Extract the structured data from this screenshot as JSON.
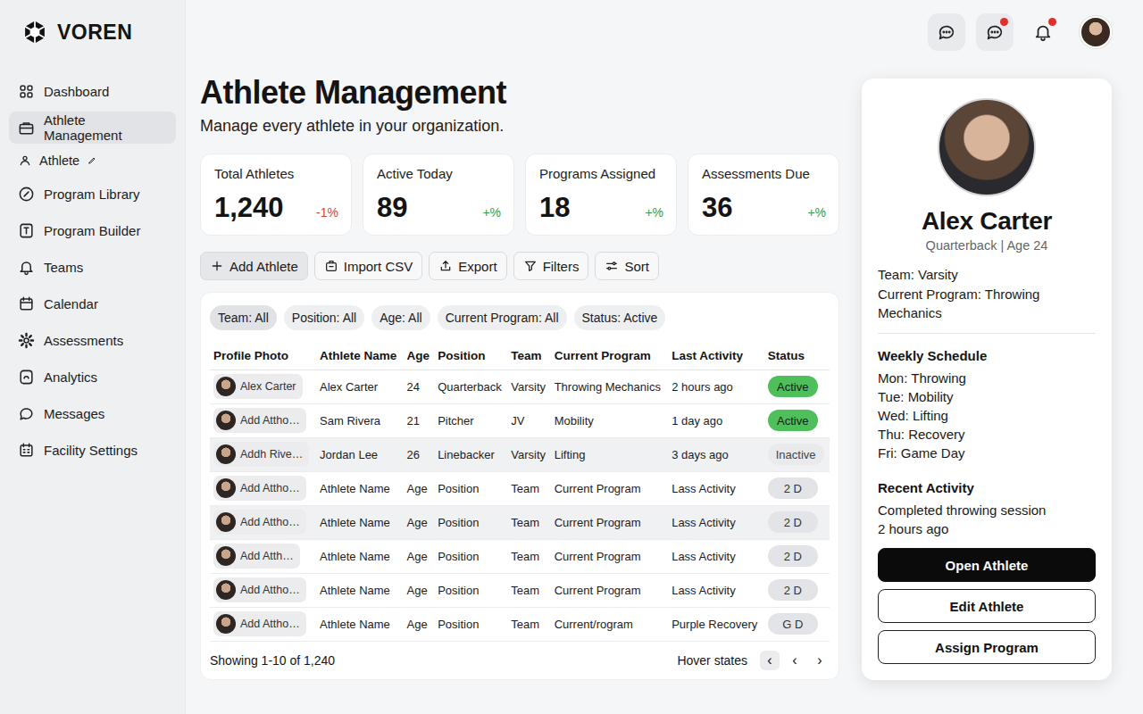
{
  "brand": {
    "name": "VOREN"
  },
  "sidebar": {
    "items": [
      {
        "label": "Dashboard",
        "selected": false,
        "kind": "main"
      },
      {
        "label": "Athlete Management",
        "selected": true,
        "kind": "main"
      },
      {
        "label": "Athlete",
        "selected": false,
        "kind": "sub"
      },
      {
        "label": "Program Library",
        "selected": false,
        "kind": "main"
      },
      {
        "label": "Program Builder",
        "selected": false,
        "kind": "main"
      },
      {
        "label": "Teams",
        "selected": false,
        "kind": "main"
      },
      {
        "label": "Calendar",
        "selected": false,
        "kind": "main"
      },
      {
        "label": "Assessments",
        "selected": false,
        "kind": "main"
      },
      {
        "label": "Analytics",
        "selected": false,
        "kind": "main"
      },
      {
        "label": "Messages",
        "selected": false,
        "kind": "main"
      },
      {
        "label": "Facility Settings",
        "selected": false,
        "kind": "main"
      }
    ]
  },
  "header": {
    "buttons": [
      {
        "badge": false
      },
      {
        "badge": true
      },
      {
        "badge": true
      }
    ]
  },
  "page": {
    "title": "Athlete Management",
    "subtitle": "Manage every athlete in your organization."
  },
  "stats": [
    {
      "label": "Total Athletes",
      "value": "1,240",
      "change": "-1%",
      "color": "#d64545"
    },
    {
      "label": "Active Today",
      "value": "89",
      "change": "+%",
      "color": "#2e9e4f"
    },
    {
      "label": "Programs Assigned",
      "value": "18",
      "change": "+%",
      "color": "#2e9e4f"
    },
    {
      "label": "Assessments Due",
      "value": "36",
      "change": "+%",
      "color": "#2e9e4f"
    }
  ],
  "toolbar": [
    {
      "label": "Add Athlete",
      "selected": true
    },
    {
      "label": "Import CSV",
      "selected": false
    },
    {
      "label": "Export",
      "selected": false
    },
    {
      "label": "Filters",
      "selected": false
    },
    {
      "label": "Sort",
      "selected": false
    }
  ],
  "filters": [
    {
      "label": "Team: All",
      "selected": true
    },
    {
      "label": "Position: All",
      "selected": false
    },
    {
      "label": "Age: All",
      "selected": false
    },
    {
      "label": "Current Program: All",
      "selected": false
    },
    {
      "label": "Status: Active",
      "selected": false
    }
  ],
  "table": {
    "columns": [
      "Profile Photo",
      "Athlete Name",
      "Age",
      "Position",
      "Team",
      "Current Program",
      "Last Activity",
      "Status"
    ],
    "rows": [
      {
        "photo_label": "Alex Carter",
        "cells": [
          "Alex Carter",
          "24",
          "Quarterback",
          "Varsity",
          "Throwing Mechanics",
          "2 hours ago"
        ],
        "status": {
          "label": "Active",
          "kind": "active"
        },
        "selected": false
      },
      {
        "photo_label": "Add Attho…",
        "cells": [
          "Sam Rivera",
          "21",
          "Pitcher",
          "JV",
          "Mobility",
          "1 day ago"
        ],
        "status": {
          "label": "Active",
          "kind": "active"
        },
        "selected": false
      },
      {
        "photo_label": "Addh Rive…",
        "cells": [
          "Jordan Lee",
          "26",
          "Linebacker",
          "Varsity",
          "Lifting",
          "3 days ago"
        ],
        "status": {
          "label": "Inactive",
          "kind": "inactive"
        },
        "selected": true
      },
      {
        "photo_label": "Add Attho…",
        "cells": [
          "Athlete Name",
          "Age",
          "Position",
          "Team",
          "Current Program",
          "Lass Activity"
        ],
        "status": {
          "label": "2 D",
          "kind": "pending"
        },
        "selected": false
      },
      {
        "photo_label": "Add Attho…",
        "cells": [
          "Athlete Name",
          "Age",
          "Position",
          "Team",
          "Current Program",
          "Lass Activity"
        ],
        "status": {
          "label": "2 D",
          "kind": "pending"
        },
        "selected": true
      },
      {
        "photo_label": "Add Atth…",
        "cells": [
          "Athlete Name",
          "Age",
          "Position",
          "Team",
          "Current Program",
          "Lass Activity"
        ],
        "status": {
          "label": "2 D",
          "kind": "pending"
        },
        "selected": false
      },
      {
        "photo_label": "Add Attho…",
        "cells": [
          "Athlete Name",
          "Age",
          "Position",
          "Team",
          "Current Program",
          "Lass Activity"
        ],
        "status": {
          "label": "2 D",
          "kind": "pending"
        },
        "selected": false
      },
      {
        "photo_label": "Add Attho…",
        "cells": [
          "Athlete Name",
          "Age",
          "Position",
          "Team",
          "Current/rogram",
          "Purple Recovery"
        ],
        "status": {
          "label": "G D",
          "kind": "pending"
        },
        "selected": false
      }
    ]
  },
  "footer": {
    "showing": "Showing 1-10 of 1,240",
    "hint": "Hover states",
    "pager": [
      {
        "label": "‹",
        "selected": true
      },
      {
        "label": "‹",
        "selected": false
      },
      {
        "label": "›",
        "selected": false
      }
    ]
  },
  "profile": {
    "name": "Alex Carter",
    "subtitle": "Quarterback | Age 24",
    "details": [
      "Team: Varsity",
      "Current Program: Throwing Mechanics"
    ],
    "schedule_title": "Weekly Schedule",
    "schedule": [
      "Mon: Throwing",
      "Tue: Mobility",
      "Wed: Lifting",
      "Thu: Recovery",
      "Fri: Game Day"
    ],
    "activity_title": "Recent Activity",
    "activity_text": "Completed throwing session",
    "activity_time": "2 hours ago",
    "buttons": [
      {
        "label": "Open Athlete",
        "kind": "primary"
      },
      {
        "label": "Edit Athlete",
        "kind": "secondary"
      },
      {
        "label": "Assign Program",
        "kind": "secondary"
      }
    ]
  }
}
